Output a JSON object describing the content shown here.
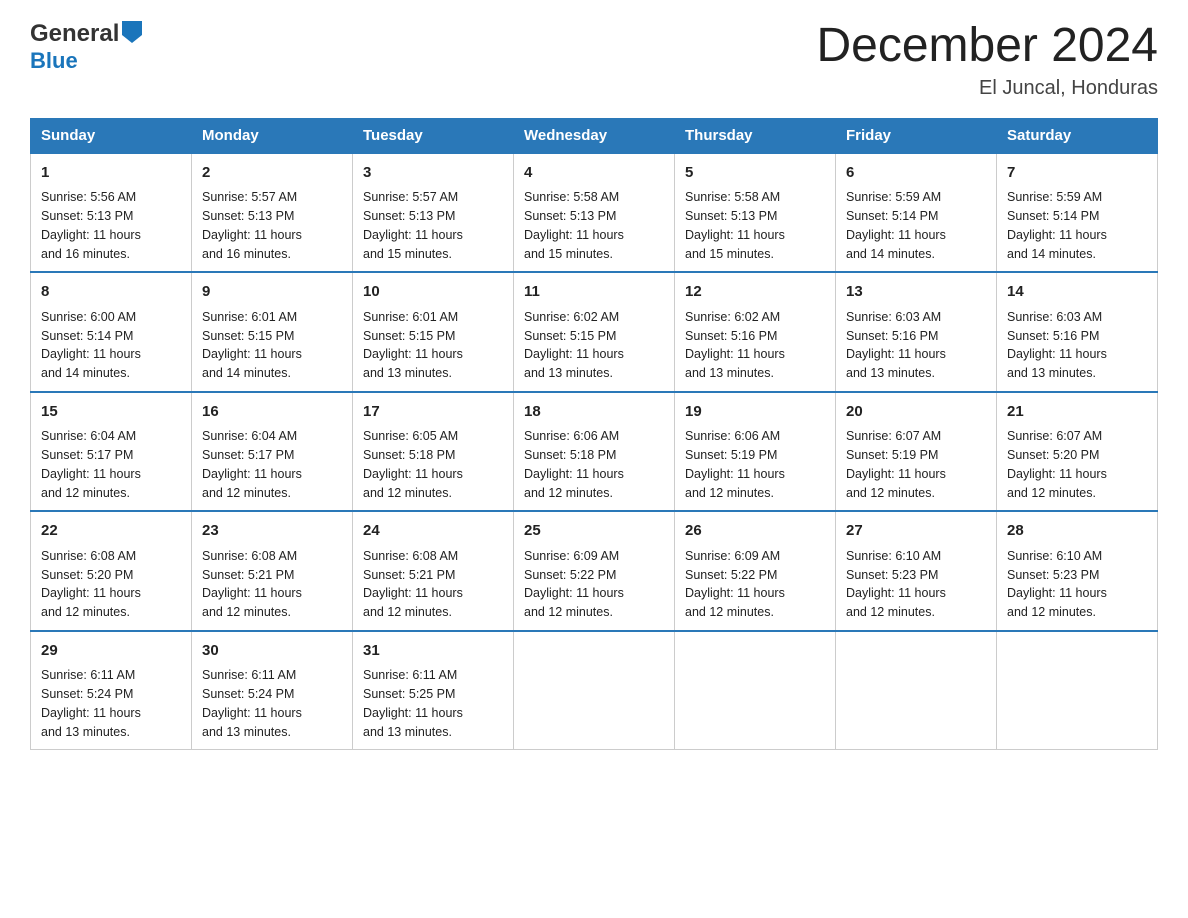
{
  "logo": {
    "line1": "General",
    "arrow": "▶",
    "line2": "Blue"
  },
  "header": {
    "title": "December 2024",
    "subtitle": "El Juncal, Honduras"
  },
  "days": [
    "Sunday",
    "Monday",
    "Tuesday",
    "Wednesday",
    "Thursday",
    "Friday",
    "Saturday"
  ],
  "weeks": [
    [
      {
        "num": "1",
        "sunrise": "5:56 AM",
        "sunset": "5:13 PM",
        "daylight": "11 hours and 16 minutes."
      },
      {
        "num": "2",
        "sunrise": "5:57 AM",
        "sunset": "5:13 PM",
        "daylight": "11 hours and 16 minutes."
      },
      {
        "num": "3",
        "sunrise": "5:57 AM",
        "sunset": "5:13 PM",
        "daylight": "11 hours and 15 minutes."
      },
      {
        "num": "4",
        "sunrise": "5:58 AM",
        "sunset": "5:13 PM",
        "daylight": "11 hours and 15 minutes."
      },
      {
        "num": "5",
        "sunrise": "5:58 AM",
        "sunset": "5:13 PM",
        "daylight": "11 hours and 15 minutes."
      },
      {
        "num": "6",
        "sunrise": "5:59 AM",
        "sunset": "5:14 PM",
        "daylight": "11 hours and 14 minutes."
      },
      {
        "num": "7",
        "sunrise": "5:59 AM",
        "sunset": "5:14 PM",
        "daylight": "11 hours and 14 minutes."
      }
    ],
    [
      {
        "num": "8",
        "sunrise": "6:00 AM",
        "sunset": "5:14 PM",
        "daylight": "11 hours and 14 minutes."
      },
      {
        "num": "9",
        "sunrise": "6:01 AM",
        "sunset": "5:15 PM",
        "daylight": "11 hours and 14 minutes."
      },
      {
        "num": "10",
        "sunrise": "6:01 AM",
        "sunset": "5:15 PM",
        "daylight": "11 hours and 13 minutes."
      },
      {
        "num": "11",
        "sunrise": "6:02 AM",
        "sunset": "5:15 PM",
        "daylight": "11 hours and 13 minutes."
      },
      {
        "num": "12",
        "sunrise": "6:02 AM",
        "sunset": "5:16 PM",
        "daylight": "11 hours and 13 minutes."
      },
      {
        "num": "13",
        "sunrise": "6:03 AM",
        "sunset": "5:16 PM",
        "daylight": "11 hours and 13 minutes."
      },
      {
        "num": "14",
        "sunrise": "6:03 AM",
        "sunset": "5:16 PM",
        "daylight": "11 hours and 13 minutes."
      }
    ],
    [
      {
        "num": "15",
        "sunrise": "6:04 AM",
        "sunset": "5:17 PM",
        "daylight": "11 hours and 12 minutes."
      },
      {
        "num": "16",
        "sunrise": "6:04 AM",
        "sunset": "5:17 PM",
        "daylight": "11 hours and 12 minutes."
      },
      {
        "num": "17",
        "sunrise": "6:05 AM",
        "sunset": "5:18 PM",
        "daylight": "11 hours and 12 minutes."
      },
      {
        "num": "18",
        "sunrise": "6:06 AM",
        "sunset": "5:18 PM",
        "daylight": "11 hours and 12 minutes."
      },
      {
        "num": "19",
        "sunrise": "6:06 AM",
        "sunset": "5:19 PM",
        "daylight": "11 hours and 12 minutes."
      },
      {
        "num": "20",
        "sunrise": "6:07 AM",
        "sunset": "5:19 PM",
        "daylight": "11 hours and 12 minutes."
      },
      {
        "num": "21",
        "sunrise": "6:07 AM",
        "sunset": "5:20 PM",
        "daylight": "11 hours and 12 minutes."
      }
    ],
    [
      {
        "num": "22",
        "sunrise": "6:08 AM",
        "sunset": "5:20 PM",
        "daylight": "11 hours and 12 minutes."
      },
      {
        "num": "23",
        "sunrise": "6:08 AM",
        "sunset": "5:21 PM",
        "daylight": "11 hours and 12 minutes."
      },
      {
        "num": "24",
        "sunrise": "6:08 AM",
        "sunset": "5:21 PM",
        "daylight": "11 hours and 12 minutes."
      },
      {
        "num": "25",
        "sunrise": "6:09 AM",
        "sunset": "5:22 PM",
        "daylight": "11 hours and 12 minutes."
      },
      {
        "num": "26",
        "sunrise": "6:09 AM",
        "sunset": "5:22 PM",
        "daylight": "11 hours and 12 minutes."
      },
      {
        "num": "27",
        "sunrise": "6:10 AM",
        "sunset": "5:23 PM",
        "daylight": "11 hours and 12 minutes."
      },
      {
        "num": "28",
        "sunrise": "6:10 AM",
        "sunset": "5:23 PM",
        "daylight": "11 hours and 12 minutes."
      }
    ],
    [
      {
        "num": "29",
        "sunrise": "6:11 AM",
        "sunset": "5:24 PM",
        "daylight": "11 hours and 13 minutes."
      },
      {
        "num": "30",
        "sunrise": "6:11 AM",
        "sunset": "5:24 PM",
        "daylight": "11 hours and 13 minutes."
      },
      {
        "num": "31",
        "sunrise": "6:11 AM",
        "sunset": "5:25 PM",
        "daylight": "11 hours and 13 minutes."
      },
      null,
      null,
      null,
      null
    ]
  ],
  "labels": {
    "sunrise": "Sunrise:",
    "sunset": "Sunset:",
    "daylight": "Daylight:"
  }
}
